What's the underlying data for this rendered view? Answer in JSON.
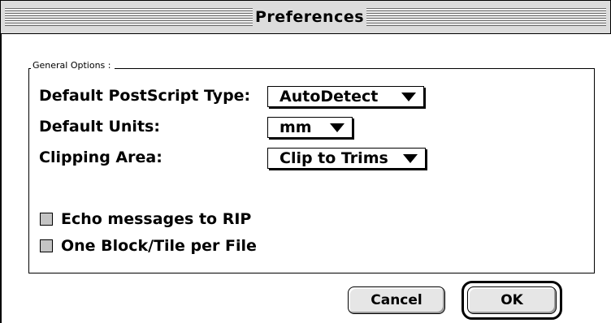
{
  "window": {
    "title": "Preferences"
  },
  "general_options": {
    "legend": "General Options :",
    "fields": {
      "postscript_type": {
        "label": "Default PostScript Type:",
        "value": "AutoDetect"
      },
      "units": {
        "label": "Default Units:",
        "value": "mm"
      },
      "clipping_area": {
        "label": "Clipping Area:",
        "value": "Clip to Trims"
      }
    },
    "checkboxes": {
      "echo_messages": {
        "label": "Echo messages to RIP",
        "checked": false
      },
      "one_block_per_file": {
        "label": "One Block/Tile per File",
        "checked": false
      }
    }
  },
  "buttons": {
    "cancel": "Cancel",
    "ok": "OK"
  },
  "icons": {
    "popup_arrow": "triangle-down-icon"
  }
}
